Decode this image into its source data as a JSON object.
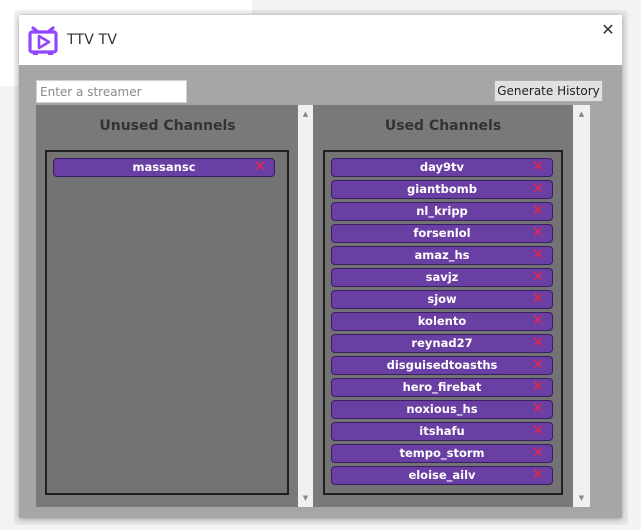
{
  "window": {
    "title": "TTV TV",
    "close_glyph": "✕",
    "icon": "twitch-tv-logo-icon",
    "accent_color": "#9147ff"
  },
  "toolbar": {
    "search_placeholder": "Enter a streamer",
    "search_value": "",
    "generate_label": "Generate History"
  },
  "unused": {
    "title": "Unused Channels",
    "channels": [
      {
        "name": "massansc"
      }
    ]
  },
  "used": {
    "title": "Used Channels",
    "channels": [
      {
        "name": "day9tv"
      },
      {
        "name": "giantbomb"
      },
      {
        "name": "nl_kripp"
      },
      {
        "name": "forsenlol"
      },
      {
        "name": "amaz_hs"
      },
      {
        "name": "savjz"
      },
      {
        "name": "sjow"
      },
      {
        "name": "kolento"
      },
      {
        "name": "reynad27"
      },
      {
        "name": "disguisedtoasths"
      },
      {
        "name": "hero_firebat"
      },
      {
        "name": "noxious_hs"
      },
      {
        "name": "itshafu"
      },
      {
        "name": "tempo_storm"
      },
      {
        "name": "eloise_ailv"
      }
    ]
  },
  "chip": {
    "remove_glyph": "✕",
    "color": "#6a3fa3",
    "remove_color": "#e0284e"
  },
  "scrollbar": {
    "up_glyph": "▲",
    "down_glyph": "▼"
  }
}
